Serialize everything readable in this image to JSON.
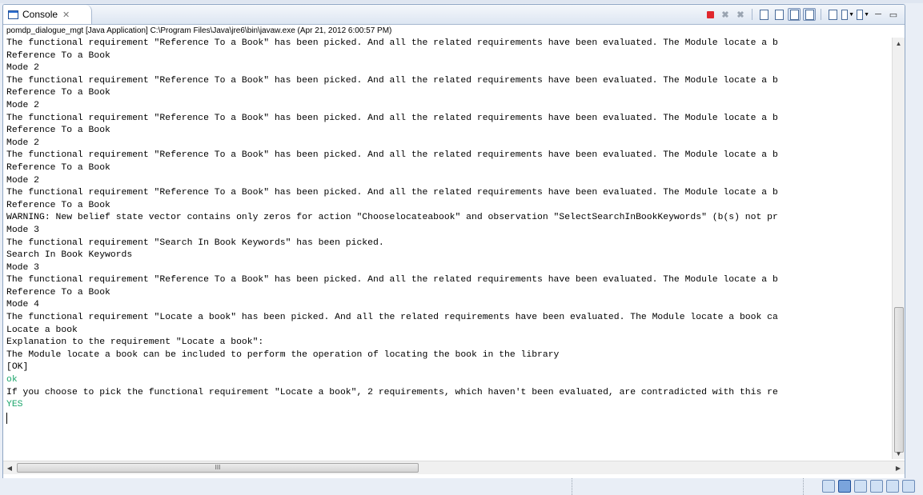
{
  "tab": {
    "title": "Console",
    "close_glyph": "✕"
  },
  "toolbar": {
    "icons": [
      "terminate-icon",
      "remove-launch-icon",
      "remove-all-icon",
      "clear-console-icon",
      "scroll-lock-icon",
      "show-stdout-icon",
      "show-stderr-icon",
      "pin-console-icon",
      "display-console-icon",
      "open-console-icon",
      "minimize-icon",
      "maximize-icon"
    ]
  },
  "process_label": "pomdp_dialogue_mgt [Java Application] C:\\Program Files\\Java\\jre6\\bin\\javaw.exe (Apr 21, 2012 6:00:57 PM)",
  "console": {
    "lines": [
      {
        "text": "The functional requirement \"Reference To a Book\" has been picked. And all the related requirements have been evaluated. The Module locate a b",
        "color": "black"
      },
      {
        "text": "Reference To a Book",
        "color": "black"
      },
      {
        "text": "Mode 2",
        "color": "black"
      },
      {
        "text": "The functional requirement \"Reference To a Book\" has been picked. And all the related requirements have been evaluated. The Module locate a b",
        "color": "black"
      },
      {
        "text": "Reference To a Book",
        "color": "black"
      },
      {
        "text": "Mode 2",
        "color": "black"
      },
      {
        "text": "The functional requirement \"Reference To a Book\" has been picked. And all the related requirements have been evaluated. The Module locate a b",
        "color": "black"
      },
      {
        "text": "Reference To a Book",
        "color": "black"
      },
      {
        "text": "Mode 2",
        "color": "black"
      },
      {
        "text": "The functional requirement \"Reference To a Book\" has been picked. And all the related requirements have been evaluated. The Module locate a b",
        "color": "black"
      },
      {
        "text": "Reference To a Book",
        "color": "black"
      },
      {
        "text": "Mode 2",
        "color": "black"
      },
      {
        "text": "The functional requirement \"Reference To a Book\" has been picked. And all the related requirements have been evaluated. The Module locate a b",
        "color": "black"
      },
      {
        "text": "Reference To a Book",
        "color": "black"
      },
      {
        "text": "WARNING: New belief state vector contains only zeros for action \"Chooselocateabook\" and observation \"SelectSearchInBookKeywords\" (b(s) not pr",
        "color": "black"
      },
      {
        "text": "Mode 3",
        "color": "black"
      },
      {
        "text": "The functional requirement \"Search In Book Keywords\" has been picked.",
        "color": "black"
      },
      {
        "text": "Search In Book Keywords",
        "color": "black"
      },
      {
        "text": "Mode 3",
        "color": "black"
      },
      {
        "text": "The functional requirement \"Reference To a Book\" has been picked. And all the related requirements have been evaluated. The Module locate a b",
        "color": "black"
      },
      {
        "text": "Reference To a Book",
        "color": "black"
      },
      {
        "text": "Mode 4",
        "color": "black"
      },
      {
        "text": "The functional requirement \"Locate a book\" has been picked. And all the related requirements have been evaluated. The Module locate a book ca",
        "color": "black"
      },
      {
        "text": "Locate a book",
        "color": "black"
      },
      {
        "text": "Explanation to the requirement \"Locate a book\":",
        "color": "black"
      },
      {
        "text": "The Module locate a book can be included to perform the operation of locating the book in the library",
        "color": "black"
      },
      {
        "text": "[OK]",
        "color": "black"
      },
      {
        "text": "ok",
        "color": "green"
      },
      {
        "text": "If you choose to pick the functional requirement \"Locate a book\", 2 requirements, which haven't been evaluated, are contradicted with this re",
        "color": "black"
      },
      {
        "text": "YES",
        "color": "green"
      }
    ]
  },
  "scrollbar": {
    "hthumb_grip": "III",
    "up": "▲",
    "down": "▼",
    "left": "◀",
    "right": "▶"
  },
  "colors": {
    "accent_stop": "#e0272d",
    "input_green": "#1ea66d"
  }
}
